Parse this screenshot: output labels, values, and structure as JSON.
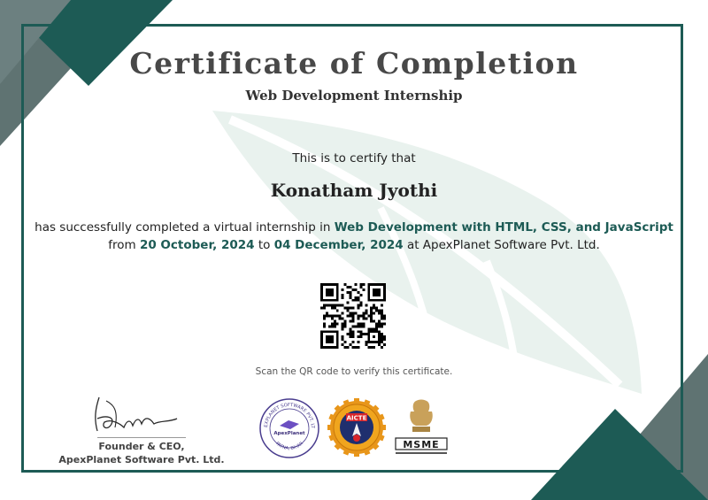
{
  "certificate": {
    "title": "Certificate of Completion",
    "subtitle": "Web Development Internship",
    "intro": "This is to certify that",
    "recipient": "Konatham Jyothi",
    "line1_prefix": "has successfully completed a virtual internship in",
    "course": "Web Development with HTML, CSS, and JavaScript",
    "line2_from": "from",
    "start_date": "20 October, 2024",
    "line2_to": "to",
    "end_date": "04 December, 2024",
    "line2_suffix": "at ApexPlanet Software Pvt. Ltd.",
    "scan_note": "Scan the QR code to verify this certificate."
  },
  "signature": {
    "role": "Founder & CEO,",
    "company": "ApexPlanet Software Pvt. Ltd."
  },
  "logos": {
    "apex_seal_ring": "APEXPLANET SOFTWARE PVT. LTD.",
    "apex_seal_bottom": "PATNA, BIHAR",
    "apex_seal_center": "ApexPlanet",
    "aicte": "AICTE",
    "msme": "MSME"
  },
  "colors": {
    "accent": "#1d5b55",
    "corner_gray": "#5f7372",
    "watermark": "#e9f2ee"
  }
}
